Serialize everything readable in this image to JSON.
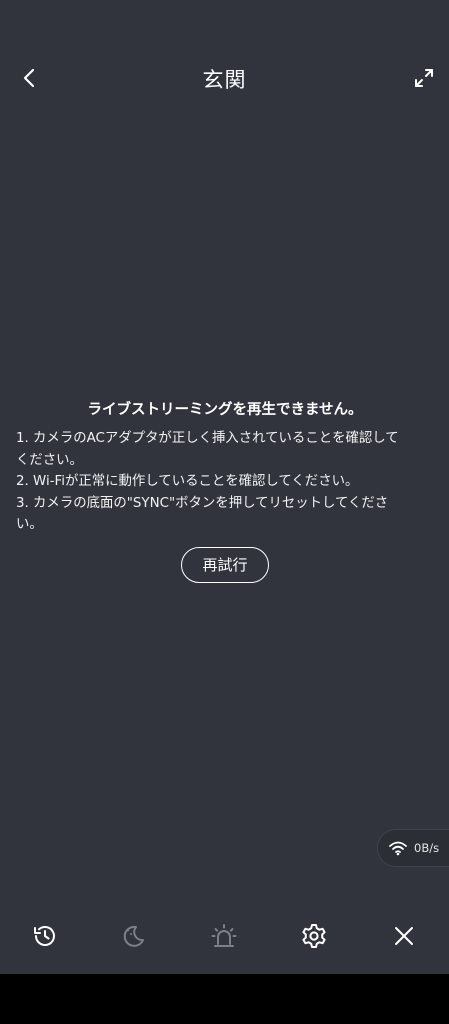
{
  "header": {
    "title": "玄関"
  },
  "error": {
    "title": "ライブストリーミングを再生できません。",
    "lines": [
      "1. カメラのACアダプタが正しく挿入されていることを確認して",
      "ください。",
      "2. Wi-Fiが正常に動作していることを確認してください。",
      "3. カメラの底面の\"SYNC\"ボタンを押してリセットしてくださ",
      "い。"
    ],
    "retry_label": "再試行"
  },
  "network": {
    "speed": "0B/s",
    "icon": "wifi-icon"
  },
  "toolbar": {
    "items": [
      {
        "icon": "playback-history-icon",
        "enabled": true
      },
      {
        "icon": "night-mode-icon",
        "enabled": false
      },
      {
        "icon": "siren-alarm-icon",
        "enabled": false
      },
      {
        "icon": "settings-gear-icon",
        "enabled": true
      },
      {
        "icon": "close-icon",
        "enabled": true
      }
    ]
  },
  "colors": {
    "background": "#31343c",
    "text": "#ffffff",
    "disabled_icon": "#7d8088"
  }
}
